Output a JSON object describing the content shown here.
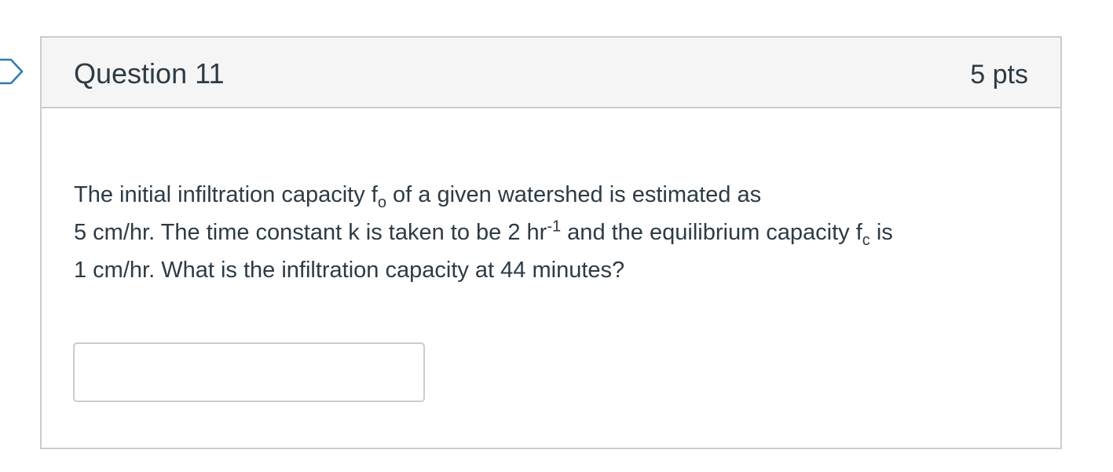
{
  "question": {
    "title": "Question 11",
    "points": "5 pts",
    "text": {
      "line1_before_sub": "The initial infiltration capacity f",
      "sub_o": "o",
      "line1_after_sub": " of a given watershed is estimated as",
      "line2_before_sup": "5 cm/hr. The time constant k is taken to be 2 hr",
      "sup_exp": "-1",
      "line2_mid": " and the equilibrium capacity f",
      "sub_c": "c",
      "line2_after_sub": " is",
      "line3": "1 cm/hr. What is the infiltration capacity at 44 minutes?"
    },
    "answer": {
      "value": "",
      "placeholder": ""
    }
  },
  "icons": {
    "flag": "question-flag-icon"
  },
  "colors": {
    "text": "#2d3b45",
    "border": "#c7cdd1",
    "header_bg": "#f5f5f5"
  }
}
